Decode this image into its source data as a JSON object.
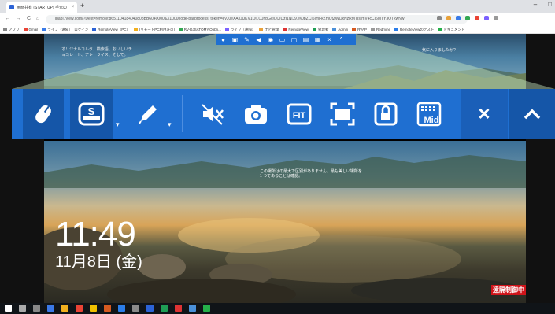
{
  "browser": {
    "tab_title": "画面共有 (STARTUP) 手元の PC …",
    "new_tab": "+",
    "window_controls": [
      "–",
      "□"
    ],
    "nav": [
      "←",
      "→",
      "C",
      "⌂"
    ],
    "url": "ibapi.rview.com/?Dest=remote:8651104184040808BB6040000&X1000node-pallprocess_token=eyJ0eXAiOiJKV1QiLCJhbGciOiJIUzI1NiJ9.eyJpZCI6ImFkZmUtZWQxNzlkMTIsImV4cCI6MTY3OTkwNw",
    "bookmarks": [
      "アプリ",
      "Gmail",
      "ライフ（遠隔）_ログイン",
      "RemoteView（PC）",
      "[リモートPC利用許可]",
      "RV-DJSATQMYiQpbn...",
      "ライフ（遠隔）",
      "ナビ管理",
      "RemoteView",
      "管理者",
      "Admin",
      "RVAP",
      "Redmine",
      "RemoteViewのテスト",
      "ドキュメント"
    ]
  },
  "mini_toolbar": {
    "icons": [
      "mouse-icon",
      "keyboard-icon",
      "pen-icon",
      "mute-icon",
      "camera-icon",
      "fit-icon",
      "fullscreen-icon",
      "lock-icon",
      "mid-icon",
      "close-icon",
      "collapse-icon"
    ]
  },
  "remote_screen": {
    "hint_left": "オリジナルコルタ、検索語、おいしいチョコレート、アレーライス、そして。",
    "hint_right": "気に入りましたか?",
    "spotlight_note": "この場所はの最大で区別がありません。最も美しい場所を 1 つであることは確認。",
    "clock": "11:49",
    "date": "11月8日 (金)",
    "remote_badge": "遠隔制御中"
  },
  "toolbar": {
    "fit_label": "FIT",
    "mid_label": "Mid",
    "keyboard_letter": "S",
    "close_label": "×",
    "collapse_label": "^"
  },
  "colors": {
    "toolbar_blue": "#1f6fd1",
    "toolbar_selected": "#1556a8",
    "remote_badge": "#d0141a"
  }
}
